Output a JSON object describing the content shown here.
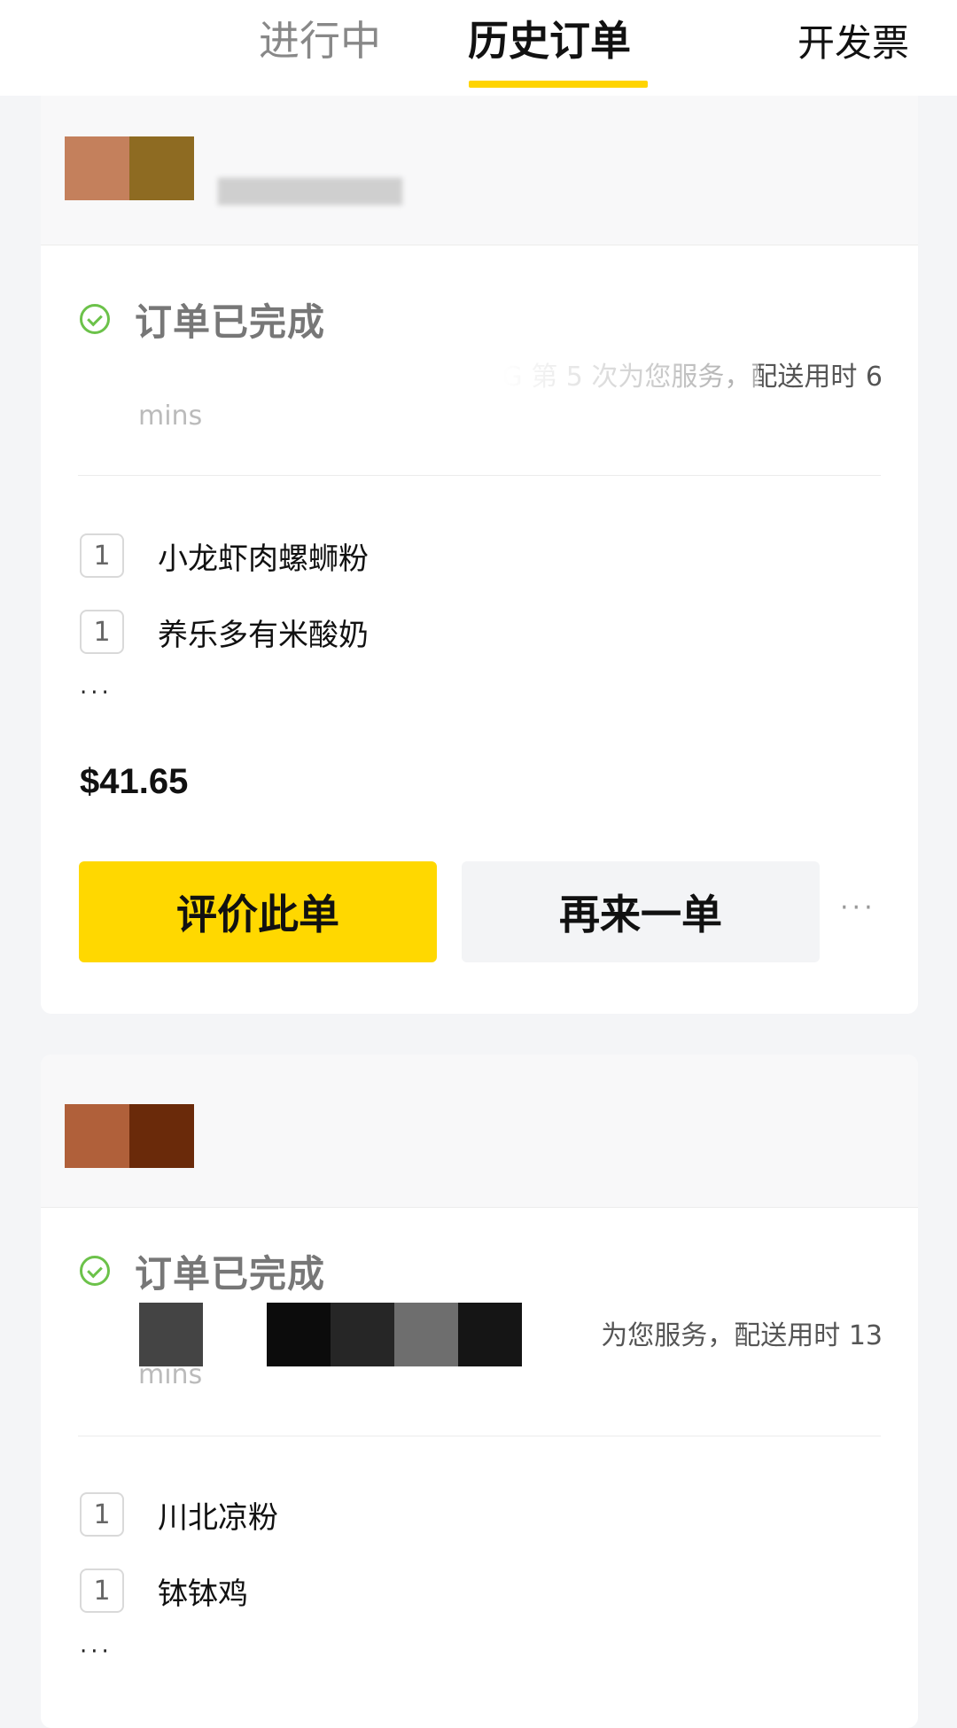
{
  "header": {
    "tabs": [
      {
        "label": "进行中",
        "active": false
      },
      {
        "label": "历史订单",
        "active": true
      }
    ],
    "right_link": "开发票"
  },
  "colors": {
    "accent": "#ffd400",
    "status_green": "#6cc24a",
    "logo_1": [
      "#c4805c",
      "#8e6b22"
    ],
    "logo_2": [
      "#b0603a",
      "#6a2a0a"
    ]
  },
  "orders": [
    {
      "status": "订单已完成",
      "status_icon": "check-circle-icon",
      "rider_line1": "HONG 第 5 次为您服务，配送用时 6",
      "rider_line2": "mins",
      "items": [
        {
          "qty": "1",
          "name": "小龙虾肉螺蛳粉"
        },
        {
          "qty": "1",
          "name": "养乐多有米酸奶"
        }
      ],
      "more": "···",
      "price": "$41.65",
      "primary_button": "评价此单",
      "secondary_button": "再来一单",
      "more_menu": "···"
    },
    {
      "status": "订单已完成",
      "status_icon": "check-circle-icon",
      "rider_line1": "为您服务，配送用时 13",
      "rider_line2": "mins",
      "items": [
        {
          "qty": "1",
          "name": "川北凉粉"
        },
        {
          "qty": "1",
          "name": "钵钵鸡"
        }
      ],
      "more": "···"
    }
  ]
}
